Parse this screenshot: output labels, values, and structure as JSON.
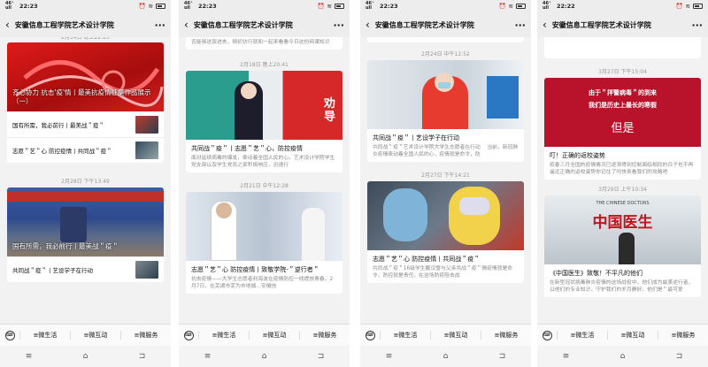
{
  "menu": {
    "m1": "≡微生活",
    "m2": "≡微互动",
    "m3": "≡微服务"
  },
  "nav": {
    "i1": "≡",
    "i2": "⌂",
    "i3": "⊐"
  },
  "screens": [
    {
      "status_time": "22:23",
      "title": "安徽信息工程学院艺术设计学院",
      "top_ts": "2月14日 晚上22:23",
      "card1_overlay": "齐心协力 抗击'疫'情丨最美抗疫情征集作品展示（一）",
      "card1_rows": [
        "国有所需，我必前行丨最美战＂疫＂",
        "志愿＂艺＂心 防控疫情丨共同战＂疫＂"
      ],
      "ts2": "2月28日 下午13:49",
      "card2_overlay": "国有所需，我必前行丨最美战＂疫＂",
      "card2_rows": [
        "共同战＂疫＂丨艺设学子在行动"
      ]
    },
    {
      "status_time": "22:23",
      "title": "安徽信息工程学院艺术设计学院",
      "top_text": "否能够送饭进去，顿初彷行就和一起来看看今日这份网课知识",
      "ts1": "2月18日 晚上20:41",
      "card1_title": "共同战＂疫＂丨志愿＂艺＂心，防控疫情",
      "card1_desc": "面对延续病毒的爆发，牵动着全国人民的心。艺术设计学院学生党支部以及学生党员之家积极响应，迅速行",
      "ts2": "2月21日 中午12:28",
      "card2_title": "志愿＂艺＂心 防控疫情丨致敬学院-＂逆行者＂",
      "card2_desc": "抗击疫情——大学生志愿者利海波在疫情防控一线提放青春。2月7日，在芜湖市芜为市地城…安徽信"
    },
    {
      "status_time": "22:23",
      "title": "安徽信息工程学院艺术设计学院",
      "ts1": "2月24日 中午12:52",
      "card1_title": "共同战＂疫＂丨艺设学子在行动",
      "card1_desc": "共同战＂疫＂艺术设计学院大学生志愿者在行动 　当前，新冠肺炎疫情牵动着全国人民的心，疫情就是命令，防",
      "ts2": "2月27日 下午14:21",
      "card2_title": "志愿＂艺＂心 防控疫情丨共同战＂疫＂",
      "card2_desc": "共同战＂疫＂16级学生戴汉雪与父亲共战＂疫＂情疫情就是命令，防控就是责任。在这场防疫阻击战"
    },
    {
      "status_time": "22:22",
      "title": "安徽信息工程学院艺术设计学院",
      "ts1": "3月27日 下午15:04",
      "card1_img_text1": "由于＂抨警病毒＂的到来",
      "card1_img_text2": "我们是历史上最长的寒假",
      "card1_img_text3": "但是",
      "card1_title": "叮！正确的返校姿势",
      "card1_desc": "疫春三月全国的疫情情况已逐渐得到控制面临相同的日子也不再遥远正确的返校姿势你记住了吗快来看我们的攻略吧",
      "ts2": "3月29日 上午10:34",
      "card2_img_en": "THE CHINESE DOCTORS",
      "card2_img_cn": "中国医生",
      "card2_title": "《中国医生》致敬！不平凡的他们",
      "card2_desc": "在新型冠状病毒肺炎疫情的这场战役中，他们成为最美逆行者，以他们的专业知识，守护我们的岁月静好。他们是＂最可爱"
    }
  ]
}
